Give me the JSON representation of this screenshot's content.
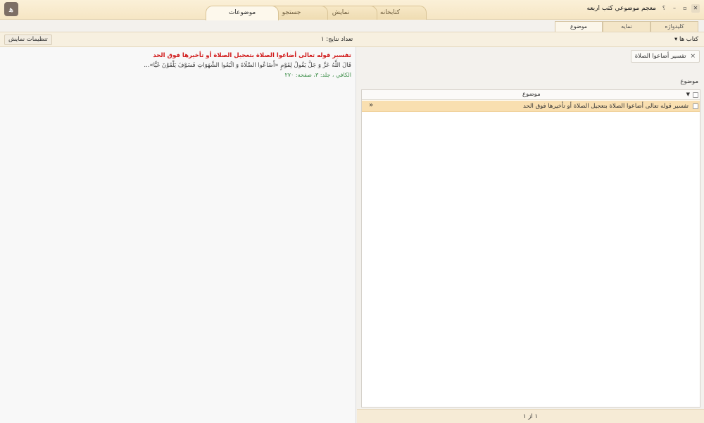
{
  "window": {
    "title": "معجم موضوعي كتب اربعه",
    "controls": [
      "؟",
      "–",
      "▫",
      "✕"
    ]
  },
  "main_tabs": [
    {
      "label": "موضوعات",
      "active": true
    },
    {
      "label": "جستجو",
      "active": false
    },
    {
      "label": "نمایش",
      "active": false
    },
    {
      "label": "کتابخانه",
      "active": false
    }
  ],
  "sub_tabs": [
    {
      "label": "موضوع",
      "active": true
    },
    {
      "label": "نمایه",
      "active": false
    },
    {
      "label": "کلیدواژه",
      "active": false
    }
  ],
  "toolbar": {
    "display_settings_label": "تنظیمات نمایش",
    "results_count": "تعداد نتایج: ۱",
    "books_dropdown": "کتاب ها"
  },
  "results": [
    {
      "title": "تفسير قوله تعالى أضاعوا الصلاة بتعجيل الصلاة أو تأخيرها فوق الحد",
      "snippet": "قَالَ اللَّهُ عَزَّ وَ جَلَّ يَقُولُ لِقَوْمٍ «أَضَاعُوا الصَّلَاةَ وَ اتَّبَعُوا الشَّهَوَاتِ فَسَوْفَ يَلْقَوْنَ غَيًّا»...",
      "source": "الكافي ، جلد: ۳، صفحه: ۲۷۰"
    }
  ],
  "filter_chip": {
    "label": "تفسیر أضاعوا الصلاة",
    "close": "×"
  },
  "topic_section_label": "موضوع",
  "grid": {
    "header_label": "موضوع",
    "rows": [
      {
        "text": "تفسير قوله تعالى أضاعوا الصلاة بتعجيل الصلاة أو تأخيرها فوق الحد",
        "expand": "»"
      }
    ]
  },
  "pager": "۱ از ۱",
  "colors": {
    "accent": "#f9dfb0",
    "title_red": "#d11b1b",
    "source_green": "#3e8e4a"
  }
}
